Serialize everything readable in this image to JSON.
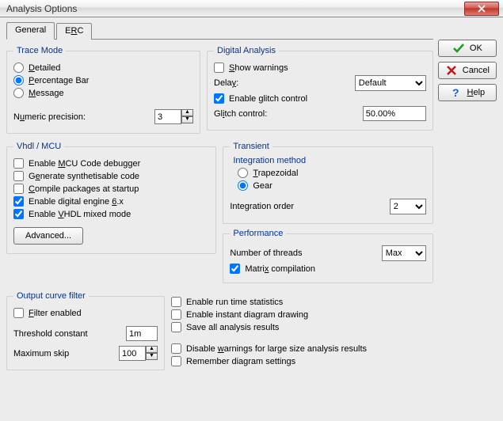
{
  "window": {
    "title": "Analysis Options"
  },
  "tabs": {
    "general": "General",
    "erc_pre": "E",
    "erc_u": "R",
    "erc_post": "C"
  },
  "trace": {
    "legend": "Trace Mode",
    "detailed_u": "D",
    "detailed": "etailed",
    "percent_u": "P",
    "percent": "ercentage Bar",
    "message_u": "M",
    "message": "essage",
    "precision_pre": "N",
    "precision_u": "u",
    "precision_post": "meric precision:",
    "precision_val": "3"
  },
  "digital": {
    "legend": "Digital Analysis",
    "show_u": "S",
    "show": "how warnings",
    "delay_pre": "Dela",
    "delay_u": "y",
    "delay_post": ":",
    "delay_sel": "Default",
    "glitch_en_pre": "Enable ",
    "glitch_en_u": "g",
    "glitch_en_post": "litch control",
    "glitch_pre": "Gl",
    "glitch_u": "i",
    "glitch_post": "tch control:",
    "glitch_val": "50.00%"
  },
  "vhdl": {
    "legend": "Vhdl / MCU",
    "mcu_pre": "Enable ",
    "mcu_u": "M",
    "mcu_post": "CU Code debugger",
    "gen_pre": "G",
    "gen_u": "e",
    "gen_post": "nerate synthetisable code",
    "comp_u": "C",
    "comp": "ompile packages at startup",
    "dig_pre": "Enable digital engine ",
    "dig_u": "6",
    "dig_post": ".x",
    "vmm_pre": "Enable ",
    "vmm_u": "V",
    "vmm_post": "HDL mixed mode",
    "adv": "Advanced..."
  },
  "transient": {
    "legend": "Transient",
    "integ_title": "Integration method",
    "trap_u": "T",
    "trap": "rapezoidal",
    "gear": "Gear",
    "order": "Integration order",
    "order_sel": "2"
  },
  "perf": {
    "legend": "Performance",
    "threads": "Number of threads",
    "threads_sel": "Max",
    "matrix_pre": "Matri",
    "matrix_u": "x",
    "matrix_post": " compilation"
  },
  "output": {
    "legend": "Output curve filter",
    "filter_u": "F",
    "filter": "ilter enabled",
    "thresh": "Threshold constant",
    "thresh_val": "1m",
    "max": "Maximum skip",
    "max_val": "100"
  },
  "opts": {
    "runtime": "Enable run time statistics",
    "instant": "Enable instant diagram drawing",
    "saveall": "Save all analysis results",
    "disable_pre": "Disable ",
    "disable_u": "w",
    "disable_post": "arnings for large size analysis results",
    "remember": "Remember diagram settings"
  },
  "side": {
    "ok": "OK",
    "cancel": "Cancel",
    "help_u": "H",
    "help": "elp"
  }
}
